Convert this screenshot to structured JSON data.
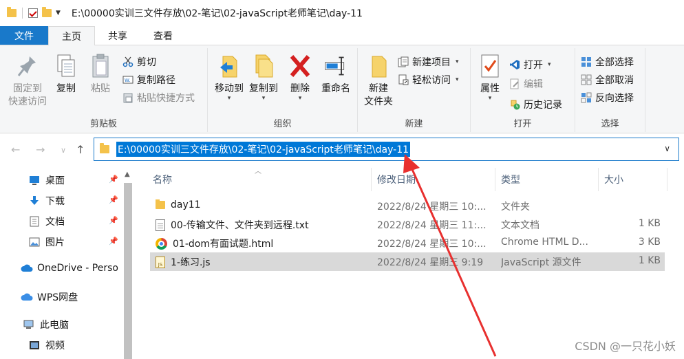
{
  "title": "E:\\00000实训三文件存放\\02-笔记\\02-javaScript老师笔记\\day-11",
  "tabs": [
    "文件",
    "主页",
    "共享",
    "查看"
  ],
  "ribbon": {
    "clipboard": {
      "label": "剪贴板",
      "pin": "固定到\n快速访问",
      "pin_l1": "固定到",
      "pin_l2": "快速访问",
      "copy": "复制",
      "paste": "粘贴",
      "cut": "剪切",
      "copy_path": "复制路径",
      "paste_shortcut": "粘贴快捷方式"
    },
    "organize": {
      "label": "组织",
      "move_to": "移动到",
      "copy_to": "复制到",
      "delete": "删除",
      "rename": "重命名"
    },
    "new": {
      "label": "新建",
      "new_folder_l1": "新建",
      "new_folder_l2": "文件夹",
      "new_item": "新建项目",
      "easy_access": "轻松访问"
    },
    "open": {
      "label": "打开",
      "properties": "属性",
      "open": "打开",
      "edit": "编辑",
      "history": "历史记录"
    },
    "select": {
      "label": "选择",
      "select_all": "全部选择",
      "select_none": "全部取消",
      "invert": "反向选择"
    }
  },
  "address": "E:\\00000实训三文件存放\\02-笔记\\02-javaScript老师笔记\\day-11",
  "nav": {
    "quick": [
      "桌面",
      "下载",
      "文档",
      "图片"
    ],
    "onedrive": "OneDrive - Perso",
    "wps": "WPS网盘",
    "thispc": "此电脑",
    "videos": "视频"
  },
  "columns": {
    "name": "名称",
    "date": "修改日期",
    "type": "类型",
    "size": "大小"
  },
  "files": [
    {
      "name": "day11",
      "date": "2022/8/24 星期三 10:...",
      "type": "文件夹",
      "size": ""
    },
    {
      "name": "00-传输文件、文件夹到远程.txt",
      "date": "2022/8/24 星期三 11:...",
      "type": "文本文档",
      "size": "1 KB"
    },
    {
      "name": "01-dom有面试题.html",
      "date": "2022/8/24 星期三 10:...",
      "type": "Chrome HTML D...",
      "size": "3 KB"
    },
    {
      "name": "1-练习.js",
      "date": "2022/8/24 星期三 9:19",
      "type": "JavaScript 源文件",
      "size": "1 KB"
    }
  ],
  "watermark": "CSDN @一只花小妖",
  "colors": {
    "accent": "#1979ca",
    "selection": "#0078d7",
    "arrow": "#e8302f"
  }
}
